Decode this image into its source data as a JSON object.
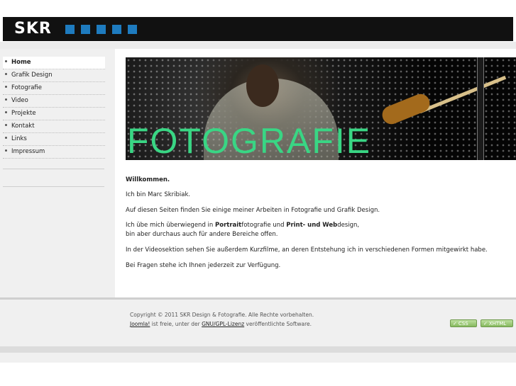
{
  "header": {
    "logo_text": "SKR",
    "accent_color": "#1e7bbf"
  },
  "sidebar": {
    "items": [
      {
        "label": "Home",
        "active": true
      },
      {
        "label": "Grafik Design"
      },
      {
        "label": "Fotografie"
      },
      {
        "label": "Video"
      },
      {
        "label": "Projekte"
      },
      {
        "label": "Kontakt"
      },
      {
        "label": "Links"
      },
      {
        "label": "Impressum"
      }
    ]
  },
  "banner": {
    "title": "FOTOGRAFIE",
    "title_color": "#39d684"
  },
  "content": {
    "welcome": "Willkommen.",
    "intro": "Ich bin Marc Skribiak.",
    "p1": "Auf diesen Seiten finden Sie einige meiner Arbeiten in Fotografie und Grafik Design.",
    "p2_a": "Ich übe mich überwiegend in ",
    "p2_b": "Portrait",
    "p2_c": "fotografie und ",
    "p2_d": "Print- und Web",
    "p2_e": "design,",
    "p2_line2": "bin aber durchaus auch für andere Bereiche offen.",
    "p3": "In der Videosektion sehen Sie außerdem Kurzfilme, an deren Entstehung ich in verschiedenen Formen mitgewirkt habe.",
    "p4": "Bei Fragen stehe ich Ihnen jederzeit zur Verfügung."
  },
  "footer": {
    "copyright": "Copyright © 2011 SKR Design & Fotografie. Alle Rechte vorbehalten.",
    "joomla_link": "Joomla!",
    "license_mid": " ist freie, unter der ",
    "gpl_link": "GNU/GPL-Lizenz",
    "license_end": " veröffentlichte Software.",
    "badges": [
      "CSS",
      "XHTML"
    ],
    "badge_color": "#86b95e"
  }
}
